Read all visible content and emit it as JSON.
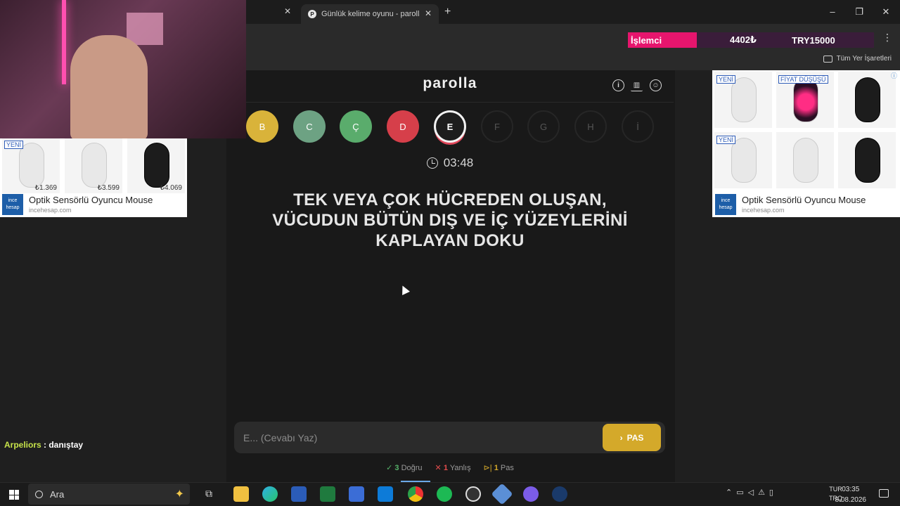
{
  "browser": {
    "active_tab_title": "Günlük kelime oyunu - parolla",
    "bookmarks_label": "Tüm Yer İşaretleri",
    "banner": {
      "label": "İşlemci",
      "price1": "4402₺",
      "price2": "TRY15000"
    }
  },
  "game": {
    "title": "parolla",
    "letters": [
      {
        "char": "B",
        "state": "correct-yellow",
        "color": "#d9b33a"
      },
      {
        "char": "C",
        "state": "done",
        "color": "#6da283"
      },
      {
        "char": "Ç",
        "state": "done",
        "color": "#5aac6c"
      },
      {
        "char": "D",
        "state": "wrong",
        "color": "#d63f4a"
      },
      {
        "char": "E",
        "state": "current",
        "color": "#1d1d1d"
      },
      {
        "char": "F",
        "state": "future",
        "color": "#262626"
      },
      {
        "char": "G",
        "state": "future",
        "color": "#262626"
      },
      {
        "char": "H",
        "state": "future",
        "color": "#262626"
      },
      {
        "char": "İ",
        "state": "future",
        "color": "#262626"
      }
    ],
    "timer": "03:48",
    "question": "TEK VEYA ÇOK HÜCREDEN OLUŞAN, VÜCUDUN BÜTÜN DIŞ VE İÇ YÜZEYLERİNİ KAPLAYAN DOKU",
    "answer_placeholder": "E... (Cevabı Yaz)",
    "pas_button": "PAS",
    "stats": {
      "correct_count": "3",
      "correct_label": "Doğru",
      "wrong_count": "1",
      "wrong_label": "Yanlış",
      "pass_count": "1",
      "pass_label": "Pas"
    }
  },
  "ads": {
    "left": {
      "badge": "YENİ",
      "prices": [
        "₺1.369",
        "₺3.599",
        "₺4.069"
      ],
      "title": "Optik Sensörlü Oyuncu Mouse",
      "url": "incehesap.com",
      "logo": "ince hesap"
    },
    "right": {
      "badges": [
        "YENİ",
        "FİYAT DÜŞÜŞÜ",
        "YENİ"
      ],
      "title": "Optik Sensörlü Oyuncu Mouse",
      "url": "incehesap.com",
      "logo": "ince hesap"
    }
  },
  "chat": {
    "user": "Arpeliors",
    "message": " : danıştay"
  },
  "taskbar": {
    "search_label": "Ara",
    "lang_top": "TUR",
    "lang_bottom": "TRQ",
    "time": "03:35",
    "date": "8.08.2026"
  }
}
